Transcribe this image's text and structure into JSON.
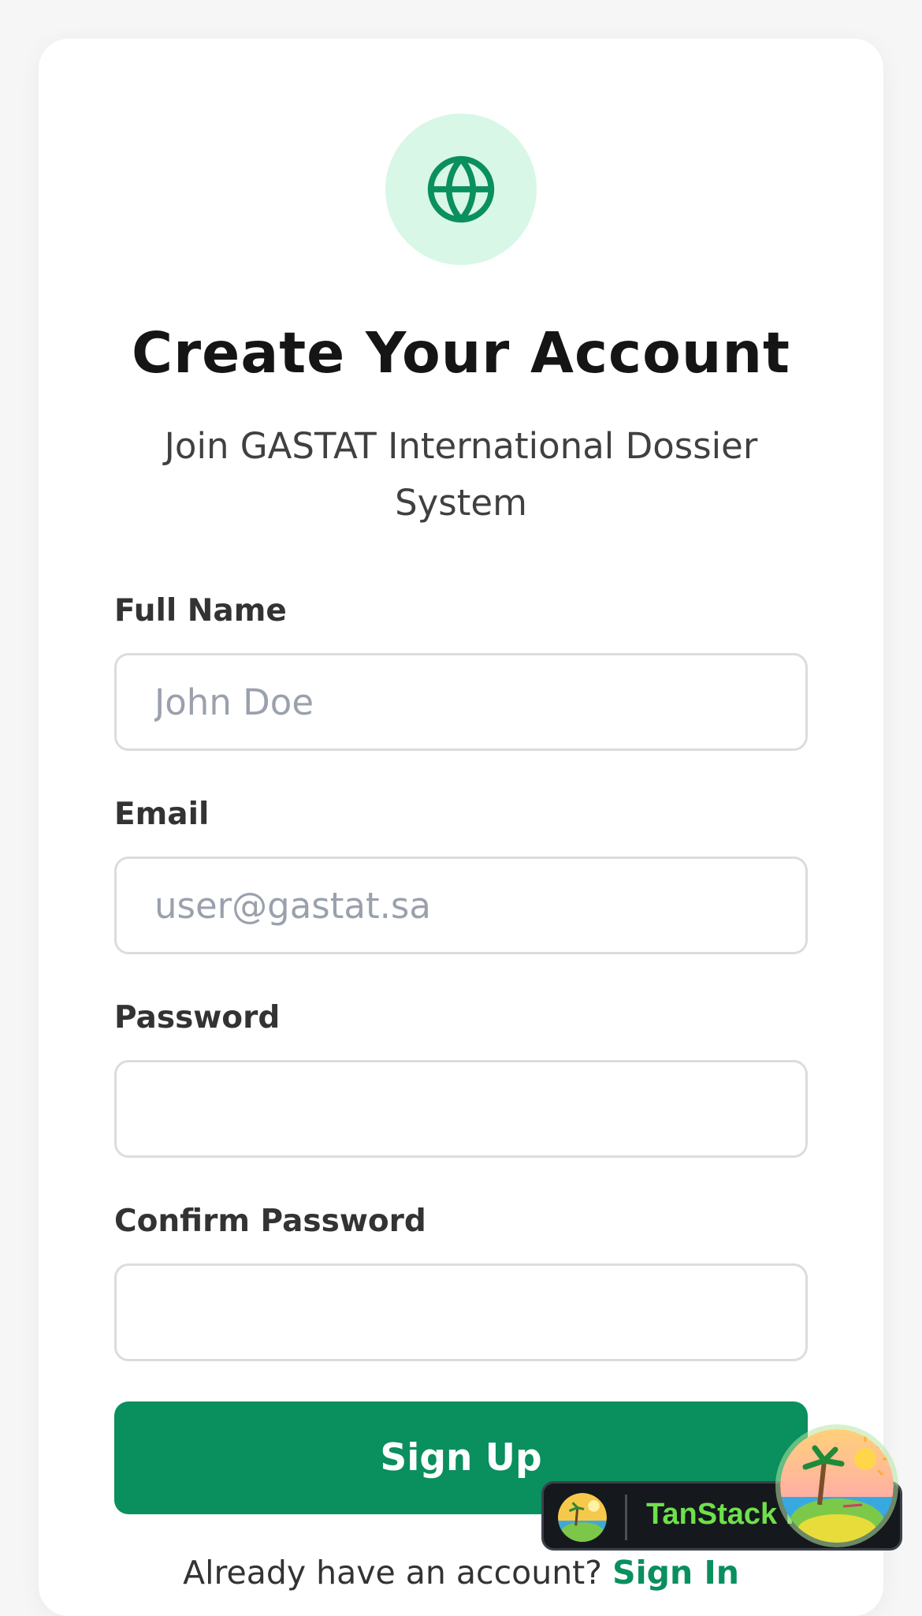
{
  "header": {
    "logo_icon": "globe-icon",
    "title": "Create Your Account",
    "subtitle": "Join GASTAT International Dossier System"
  },
  "form": {
    "full_name": {
      "label": "Full Name",
      "placeholder": "John Doe",
      "value": ""
    },
    "email": {
      "label": "Email",
      "placeholder": "user@gastat.sa",
      "value": ""
    },
    "password": {
      "label": "Password",
      "placeholder": "",
      "value": ""
    },
    "confirm_password": {
      "label": "Confirm Password",
      "placeholder": "",
      "value": ""
    },
    "submit_label": "Sign Up"
  },
  "footer": {
    "prompt": "Already have an account?",
    "signin_label": "Sign In"
  },
  "devtools": {
    "label": "TanStack R",
    "icon": "tanstack-logo-icon"
  },
  "colors": {
    "accent": "#0a8f5e",
    "logo_bg": "#d8f7e7",
    "devtools_text": "#6ee04a"
  }
}
